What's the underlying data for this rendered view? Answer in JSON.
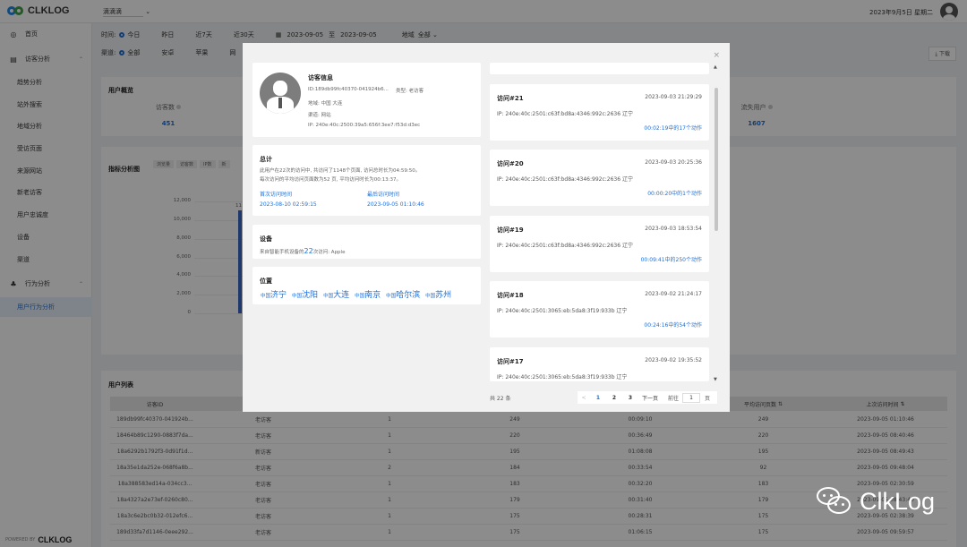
{
  "app": {
    "logo_text": "CLKLOG",
    "project": "滴滴滴",
    "datetime": "2023年9月5日 星期二"
  },
  "sidebar": {
    "items": [
      {
        "label": "首页",
        "icon": "dashboard-icon",
        "type": "top"
      },
      {
        "label": "访客分析",
        "icon": "visitor-analysis-icon",
        "type": "group"
      },
      {
        "label": "趋势分析",
        "type": "sub"
      },
      {
        "label": "站外搜索",
        "type": "sub"
      },
      {
        "label": "地域分析",
        "type": "sub"
      },
      {
        "label": "受访页面",
        "type": "sub"
      },
      {
        "label": "来源网站",
        "type": "sub"
      },
      {
        "label": "新老访客",
        "type": "sub"
      },
      {
        "label": "用户忠诚度",
        "type": "sub"
      },
      {
        "label": "设备",
        "type": "sub"
      },
      {
        "label": "渠道",
        "type": "sub"
      },
      {
        "label": "行为分析",
        "icon": "behavior-analysis-icon",
        "type": "group"
      },
      {
        "label": "用户行为分析",
        "type": "sub",
        "active": true
      }
    ],
    "powered_by": "POWERED BY",
    "powered_logo": "CLKLOG"
  },
  "filters": {
    "time_label": "时间:",
    "time_options": [
      "今日",
      "昨日",
      "近7天",
      "近30天"
    ],
    "time_selected": "今日",
    "date_from": "2023-09-05",
    "date_sep": "至",
    "date_to": "2023-09-05",
    "region_label": "地域",
    "region_value": "全部",
    "channel_label": "渠道:",
    "channel_options": [
      "全部",
      "安卓",
      "苹果",
      "网"
    ],
    "channel_selected": "全部",
    "download": "下载"
  },
  "overview": {
    "title": "用户概览",
    "visitors_label": "访客数",
    "visitors_value": "451",
    "lost_label": "流失用户",
    "lost_value": "1607"
  },
  "chart_section": {
    "title": "指标分析图",
    "chips": [
      "浏览量",
      "访客数",
      "IP数",
      "新"
    ],
    "bar_label": "11"
  },
  "chart_data": {
    "type": "bar",
    "title": "指标分析图",
    "yticks": [
      "12,000",
      "10,000",
      "8,000",
      "6,000",
      "4,000",
      "2,000",
      "0"
    ],
    "ylim": [
      0,
      12000
    ],
    "values": [
      11000
    ],
    "series_color": "#3867c7"
  },
  "user_list": {
    "title": "用户列表",
    "columns": [
      "访客ID",
      "",
      "",
      "",
      "",
      "平均访问页数",
      "上次访问时间"
    ],
    "rows": [
      [
        "189db99fc40370-041924b...",
        "老访客",
        "1",
        "249",
        "00:09:10",
        "249",
        "2023-09-05 01:10:46"
      ],
      [
        "18464b89c1290-0883f7da...",
        "老访客",
        "1",
        "220",
        "00:36:49",
        "220",
        "2023-09-05 08:40:46"
      ],
      [
        "18a6292b1792f3-0d91f1d...",
        "新访客",
        "1",
        "195",
        "01:08:08",
        "195",
        "2023-09-05 08:49:43"
      ],
      [
        "18a35e1da252e-068f6a8b...",
        "老访客",
        "2",
        "184",
        "00:33:54",
        "92",
        "2023-09-05 09:48:04"
      ],
      [
        "18a388583ed14a-034cc3...",
        "老访客",
        "1",
        "183",
        "00:32:20",
        "183",
        "2023-09-05 02:30:59"
      ],
      [
        "18a4327a2e73ef-0260c80...",
        "老访客",
        "1",
        "179",
        "00:31:40",
        "179",
        "2023-09-05 08:43:40"
      ],
      [
        "18a3c6e2bc0b32-012efc6...",
        "老访客",
        "1",
        "175",
        "00:28:31",
        "175",
        "2023-09-05 02:38:39"
      ],
      [
        "189d33fa7d1146-0eee292...",
        "老访客",
        "1",
        "175",
        "01:06:15",
        "175",
        "2023-09-05 09:59:57"
      ]
    ]
  },
  "watermark": "ClkLog",
  "modal": {
    "visitor_info": {
      "title": "访客信息",
      "id": "ID:189db99fc40370-041924b6...",
      "type": "类型: 老访客",
      "region": "地域: 中国 大连",
      "channel": "渠道: 网站",
      "ip": "IP: 240e:40c:2500:39a5:656f:3ee7:f53d:d3ec"
    },
    "summary": {
      "title": "总计",
      "line1": "此用户在22次的访问中, 共访问了1148个页面, 访问总时长为04:59:50。",
      "line2": "每次访问的平均访问页面数为52 页, 平均访问时长为00:13:37。",
      "first_label": "首次访问时间",
      "first_value": "2023-08-10 02:59:15",
      "last_label": "最后访问时间",
      "last_value": "2023-09-05 01:10:46"
    },
    "device": {
      "title": "设备",
      "pre": "来自智能手机设备的",
      "count": "22",
      "post": "次访问: Apple"
    },
    "location": {
      "title": "位置",
      "items": [
        {
          "country": "中国",
          "city": "济宁"
        },
        {
          "country": "中国",
          "city": "沈阳"
        },
        {
          "country": "中国",
          "city": "大连"
        },
        {
          "country": "中国",
          "city": "南京"
        },
        {
          "country": "中国",
          "city": "哈尔滨"
        },
        {
          "country": "中国",
          "city": "苏州"
        }
      ]
    },
    "visits": [
      {
        "title": "访问#21",
        "time": "2023-09-03 21:29:29",
        "ip": "IP:  240e:40c:2501:c63f:bd8a:4346:992c:2636  辽宁",
        "action": "00:02:19中的17个动作"
      },
      {
        "title": "访问#20",
        "time": "2023-09-03 20:25:36",
        "ip": "IP:  240e:40c:2501:c63f:bd8a:4346:992c:2636  辽宁",
        "action": "00:00:20中的1个动作"
      },
      {
        "title": "访问#19",
        "time": "2023-09-03 18:53:54",
        "ip": "IP:  240e:40c:2501:c63f:bd8a:4346:992c:2636  辽宁",
        "action": "00:09:41中的250个动作"
      },
      {
        "title": "访问#18",
        "time": "2023-09-02 21:24:17",
        "ip": "IP:  240e:40c:2501:3065:eb:5da8:3f19:933b  辽宁",
        "action": "00:24:16中的54个动作"
      },
      {
        "title": "访问#17",
        "time": "2023-09-02 19:35:52",
        "ip": "IP:  240e:40c:2501:3065:eb:5da8:3f19:933b  辽宁",
        "action": ""
      }
    ],
    "pagination": {
      "total": "共 22 条",
      "prev": "<",
      "pages": [
        "1",
        "2",
        "3"
      ],
      "next": "下一页",
      "goto_label": "前往",
      "goto_value": "1",
      "page_unit": "页"
    },
    "close": "×"
  }
}
